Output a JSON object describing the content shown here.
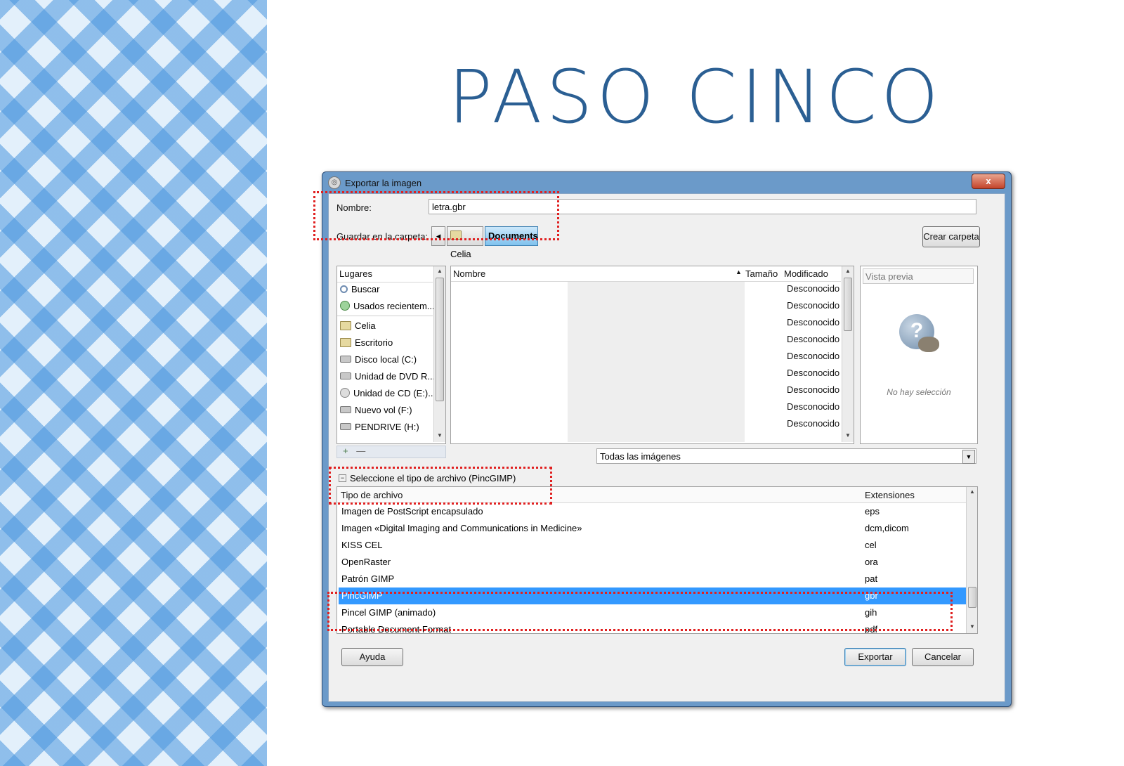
{
  "slide": {
    "title": "PASO CINCO"
  },
  "window": {
    "title": "Exportar la imagen",
    "close_label": "x"
  },
  "name_row": {
    "label": "Nombre:",
    "value": "letra.gbr"
  },
  "folder_row": {
    "label": "Guardar en la carpeta:",
    "path": [
      "Celia",
      "Documents"
    ],
    "create_folder_label": "Crear carpeta"
  },
  "places": {
    "header": "Lugares",
    "items": [
      {
        "label": "Buscar",
        "icon": "search-icon"
      },
      {
        "label": "Usados recientem...",
        "icon": "recent-icon"
      },
      {
        "label": "Celia",
        "icon": "folder-icon"
      },
      {
        "label": "Escritorio",
        "icon": "folder-icon"
      },
      {
        "label": "Disco local (C:)",
        "icon": "drive-icon"
      },
      {
        "label": "Unidad de DVD R...",
        "icon": "dvd-drive-icon"
      },
      {
        "label": "Unidad de CD (E:)...",
        "icon": "cd-drive-icon"
      },
      {
        "label": "Nuevo vol (F:)",
        "icon": "drive-icon"
      },
      {
        "label": "PENDRIVE (H:)",
        "icon": "usb-drive-icon"
      }
    ],
    "add_label": "+",
    "remove_label": "—"
  },
  "files": {
    "col_name": "Nombre",
    "col_size": "Tamaño",
    "col_modified": "Modificado",
    "sort_indicator": "▲",
    "rows": [
      "Desconocido",
      "Desconocido",
      "Desconocido",
      "Desconocido",
      "Desconocido",
      "Desconocido",
      "Desconocido",
      "Desconocido",
      "Desconocido",
      "Desconocido"
    ]
  },
  "preview": {
    "header": "Vista previa",
    "empty_text": "No hay selección"
  },
  "filter": {
    "value": "Todas las imágenes"
  },
  "filetype": {
    "expander_label": "Seleccione el tipo de archivo (PincGIMP)",
    "col_type": "Tipo de archivo",
    "col_ext": "Extensiones",
    "rows": [
      {
        "name": "Imagen de PostScript encapsulado",
        "ext": "eps"
      },
      {
        "name": "Imagen «Digital Imaging and Communications in Medicine»",
        "ext": "dcm,dicom"
      },
      {
        "name": "KISS CEL",
        "ext": "cel"
      },
      {
        "name": "OpenRaster",
        "ext": "ora"
      },
      {
        "name": "Patrón GIMP",
        "ext": "pat"
      },
      {
        "name": "PincGIMP",
        "ext": "gbr"
      },
      {
        "name": "Pincel GIMP (animado)",
        "ext": "gih"
      },
      {
        "name": "Portable Document Format",
        "ext": "pdf"
      }
    ],
    "selected_index": 5
  },
  "buttons": {
    "help": "Ayuda",
    "export": "Exportar",
    "cancel": "Cancelar"
  },
  "colors": {
    "highlight": "#3399ff",
    "annotation": "#e02020",
    "title": "#2b5f93"
  }
}
